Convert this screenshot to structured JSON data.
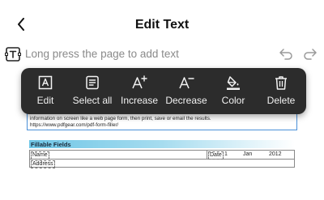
{
  "header": {
    "title": "Edit Text"
  },
  "hint": {
    "text": "Long press the page to add text"
  },
  "toolbar": {
    "items": [
      {
        "label": "Edit",
        "icon": "edit-text-icon"
      },
      {
        "label": "Select all",
        "icon": "select-all-icon"
      },
      {
        "label": "Increase",
        "icon": "increase-font-icon"
      },
      {
        "label": "Decrease",
        "icon": "decrease-font-icon"
      },
      {
        "label": "Color",
        "icon": "color-fill-icon"
      },
      {
        "label": "Delete",
        "icon": "trash-icon"
      }
    ]
  },
  "document": {
    "line1": "information on screen like a web page form, then print, save or email the results.",
    "line2": "https://www.pdfgear.com/pdf-form-filler/",
    "section_title": "Fillable Fields",
    "form": {
      "name_label": "Name",
      "date_label": "Date",
      "date_day": "1",
      "date_month": "Jan",
      "date_year": "2012",
      "address_label": "Address"
    }
  },
  "colors": {
    "toolbar_bg": "#2c2c2c",
    "accent": "#4a90d9"
  }
}
